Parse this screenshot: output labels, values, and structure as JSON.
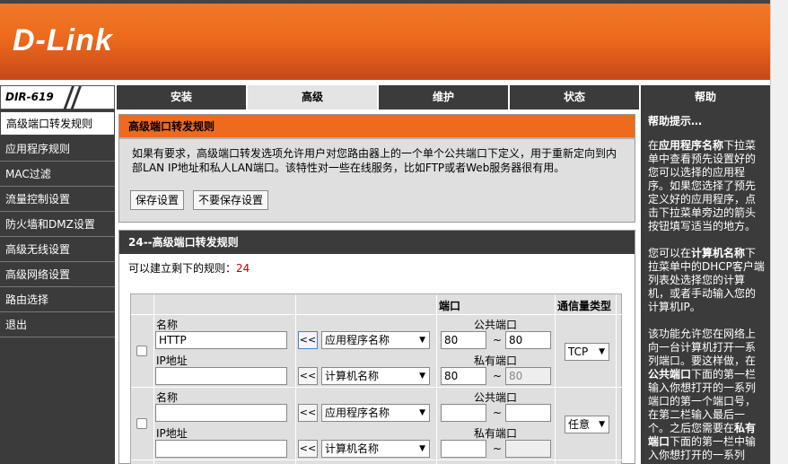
{
  "header": {
    "logo": "D-Link",
    "model": "DIR-619"
  },
  "topnav": {
    "tabs": [
      {
        "label": "安装"
      },
      {
        "label": "高级"
      },
      {
        "label": "维护"
      },
      {
        "label": "状态"
      },
      {
        "label": "帮助"
      }
    ]
  },
  "leftnav": {
    "items": [
      {
        "label": "高级端口转发规则"
      },
      {
        "label": "应用程序规则"
      },
      {
        "label": "MAC过滤"
      },
      {
        "label": "流量控制设置"
      },
      {
        "label": "防火墙和DMZ设置"
      },
      {
        "label": "高级无线设置"
      },
      {
        "label": "高级网络设置"
      },
      {
        "label": "路由选择"
      },
      {
        "label": "退出"
      }
    ]
  },
  "main": {
    "section_title": "高级端口转发规则",
    "description": "如果有要求，高级端口转发选项允许用户对您路由器上的一个单个公共端口下定义，用于重新定向到内部LAN IP地址和私人LAN端口。该特性对一些在线服务，比如FTP或者Web服务器很有用。",
    "save_label": "保存设置",
    "nosave_label": "不要保存设置",
    "rules_title": "24--高级端口转发规则",
    "avail_label": "可以建立剩下的规则：",
    "avail_count": "24",
    "col_port": "端口",
    "col_traffic": "通信量类型",
    "rows": [
      {
        "name_label": "名称",
        "name_value": "HTTP",
        "ip_label": "IP地址",
        "ip_value": "",
        "copy_btn": "<<",
        "app_select": "应用程序名称",
        "pc_select": "计算机名称",
        "public_label": "公共端口",
        "public_start": "80",
        "public_end": "80",
        "private_label": "私有端口",
        "private_start": "80",
        "private_end": "80",
        "traffic": "TCP"
      },
      {
        "name_label": "名称",
        "name_value": "",
        "ip_label": "IP地址",
        "ip_value": "",
        "copy_btn": "<<",
        "app_select": "应用程序名称",
        "pc_select": "计算机名称",
        "public_label": "公共端口",
        "public_start": "",
        "public_end": "",
        "private_label": "私有端口",
        "private_start": "",
        "private_end": "",
        "traffic": "任意"
      }
    ],
    "tilde": "~"
  },
  "help": {
    "title": "帮助提示…",
    "p1_pre": "在",
    "p1_bold": "应用程序名称",
    "p1_post": "下拉菜单中查看预先设置好的您可以选择的应用程序。如果您选择了预先定义好的应用程序，点击下拉菜单旁边的箭头按钮填写适当的地方。",
    "p2_pre": "您可以在",
    "p2_bold": "计算机名称",
    "p2_post": "下拉菜单中的DHCP客户端列表处选择您的计算机，或者手动输入您的计算机IP。",
    "p3_pre": "该功能允许您在网络上向一台计算机打开一系列端口。要这样做，在",
    "p3_bold": "公共端口",
    "p3_post": "下面的第一栏输入你想打开的一系列端口的第一个端口号，在第二栏输入最后一个。之后您需要在",
    "p3_bold2": "私有端口",
    "p3_post2": "下面的第一栏中输入你想打开的一系列"
  }
}
